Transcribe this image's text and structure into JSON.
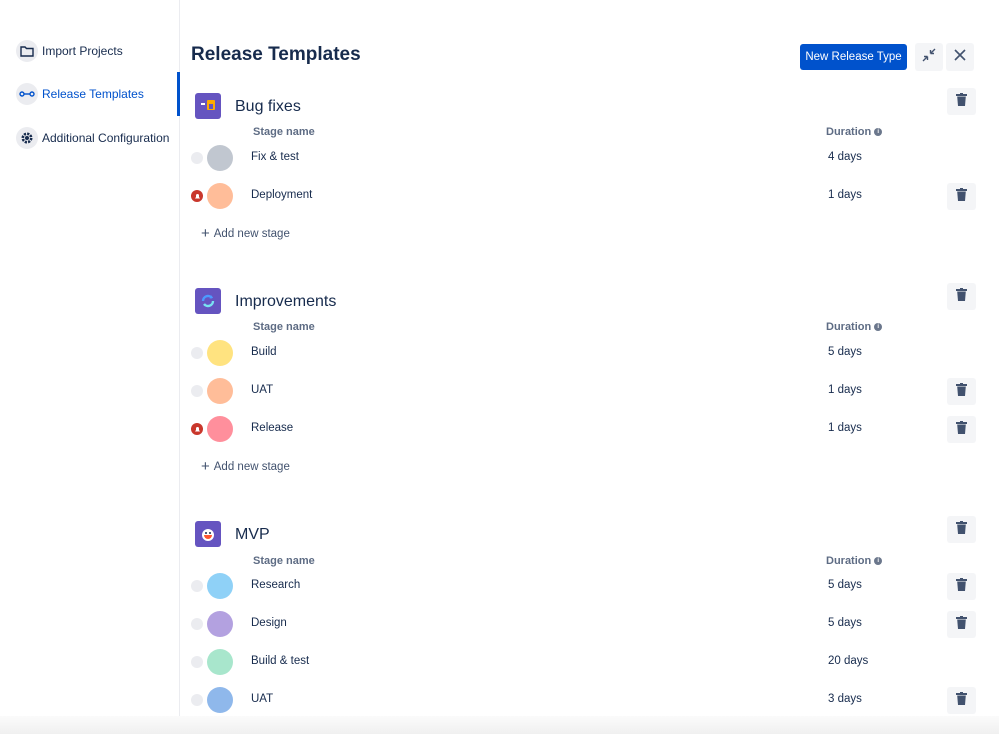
{
  "sidebar": {
    "items": [
      {
        "label": "Import Projects",
        "icon": "folder-icon"
      },
      {
        "label": "Release Templates",
        "icon": "link-icon",
        "active": true
      },
      {
        "label": "Additional Configuration",
        "icon": "gear-icon"
      }
    ]
  },
  "header": {
    "title": "Release Templates",
    "new_button_label": "New Release Type",
    "collapse_icon": "collapse-icon",
    "close_icon": "close-icon"
  },
  "columns": {
    "stage": "Stage name",
    "duration": "Duration"
  },
  "add_stage_label": "Add new stage",
  "colors": {
    "primary": "#0052cc",
    "alert": "#c9372c",
    "template_icon_bg": "#6554c0"
  },
  "templates": [
    {
      "name": "Bug fixes",
      "icon": "bug-fixes-icon",
      "stages": [
        {
          "name": "Fix & test",
          "duration": "4 days",
          "color": "#c1c7d0",
          "alert": false,
          "deletable": false
        },
        {
          "name": "Deployment",
          "duration": "1 days",
          "color": "#ffbd99",
          "alert": true,
          "deletable": true
        }
      ]
    },
    {
      "name": "Improvements",
      "icon": "improvements-icon",
      "stages": [
        {
          "name": "Build",
          "duration": "5 days",
          "color": "#ffe380",
          "alert": false,
          "deletable": false
        },
        {
          "name": "UAT",
          "duration": "1 days",
          "color": "#ffbd99",
          "alert": false,
          "deletable": true
        },
        {
          "name": "Release",
          "duration": "1 days",
          "color": "#ff8f9c",
          "alert": true,
          "deletable": true
        }
      ]
    },
    {
      "name": "MVP",
      "icon": "mvp-icon",
      "stages": [
        {
          "name": "Research",
          "duration": "5 days",
          "color": "#8fd1f7",
          "alert": false,
          "deletable": true
        },
        {
          "name": "Design",
          "duration": "5 days",
          "color": "#b3a1e0",
          "alert": false,
          "deletable": true
        },
        {
          "name": "Build & test",
          "duration": "20 days",
          "color": "#a8e6cc",
          "alert": false,
          "deletable": false
        },
        {
          "name": "UAT",
          "duration": "3 days",
          "color": "#8fb8eb",
          "alert": false,
          "deletable": true
        }
      ]
    }
  ]
}
